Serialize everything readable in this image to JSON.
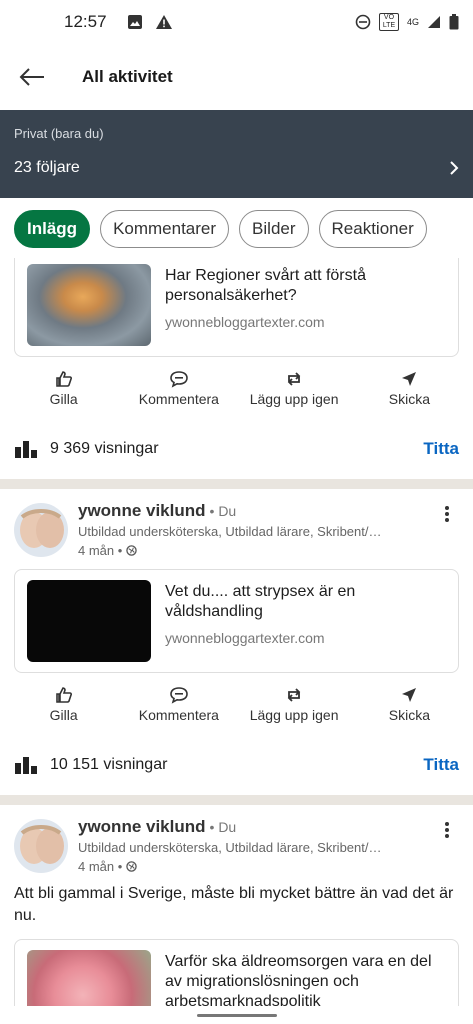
{
  "status_bar": {
    "time": "12:57",
    "network": "4G",
    "volte": "VO LTE"
  },
  "header": {
    "title": "All aktivitet"
  },
  "banner": {
    "privacy": "Privat (bara du)",
    "followers": "23 följare"
  },
  "filters": [
    {
      "label": "Inlägg",
      "active": true
    },
    {
      "label": "Kommentarer",
      "active": false
    },
    {
      "label": "Bilder",
      "active": false
    },
    {
      "label": "Reaktioner",
      "active": false
    }
  ],
  "actions": {
    "like": "Gilla",
    "comment": "Kommentera",
    "repost": "Lägg upp igen",
    "send": "Skicka"
  },
  "posts": [
    {
      "link": {
        "title": "Har Regioner svårt att förstå personalsäkerhet?",
        "site": "ywonnebloggartexter.com"
      },
      "views": "9 369 visningar",
      "views_link": "Titta"
    },
    {
      "author": {
        "name": "ywonne viklund",
        "degree": "• Du",
        "headline": "Utbildad undersköterska, Utbildad lärare, Skribent/…",
        "time": "4 mån •"
      },
      "link": {
        "title": "Vet du.... att strypsex är en våldshandling",
        "site": "ywonnebloggartexter.com"
      },
      "views": "10 151 visningar",
      "views_link": "Titta"
    },
    {
      "author": {
        "name": "ywonne viklund",
        "degree": "• Du",
        "headline": "Utbildad undersköterska, Utbildad lärare, Skribent/…",
        "time": "4 mån •"
      },
      "text": "Att bli gammal i Sverige, måste bli mycket bättre än vad det är nu.",
      "link": {
        "title": "Varför ska äldreomsorgen vara en del av migrationslösningen och arbetsmarknadspolitik"
      }
    }
  ],
  "colors": {
    "accent_green": "#057642",
    "link_blue": "#0a66c2",
    "banner": "#38434f"
  }
}
